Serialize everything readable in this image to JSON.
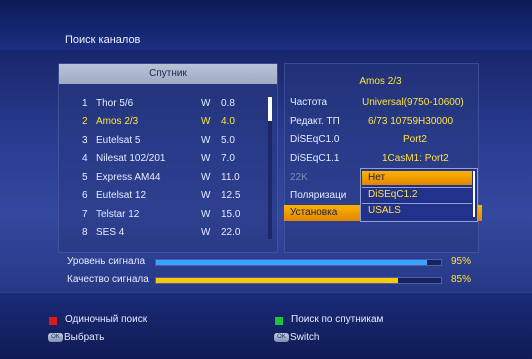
{
  "header": {
    "title": "Поиск каналов"
  },
  "satellite_panel": {
    "heading": "Спутник",
    "items": [
      {
        "num": "1",
        "name": "Thor 5/6",
        "dir": "W",
        "deg": "0.8"
      },
      {
        "num": "2",
        "name": "Amos 2/3",
        "dir": "W",
        "deg": "4.0"
      },
      {
        "num": "3",
        "name": "Eutelsat 5",
        "dir": "W",
        "deg": "5.0"
      },
      {
        "num": "4",
        "name": "Nilesat 102/201",
        "dir": "W",
        "deg": "7.0"
      },
      {
        "num": "5",
        "name": "Express AM44",
        "dir": "W",
        "deg": "11.0"
      },
      {
        "num": "6",
        "name": "Eutelsat 12",
        "dir": "W",
        "deg": "12.5"
      },
      {
        "num": "7",
        "name": "Telstar 12",
        "dir": "W",
        "deg": "15.0"
      },
      {
        "num": "8",
        "name": "SES 4",
        "dir": "W",
        "deg": "22.0"
      }
    ],
    "selected_index": 1
  },
  "params_panel": {
    "title": "Amos 2/3",
    "rows": [
      {
        "label": "Частота",
        "value": "Universal(9750-10600)"
      },
      {
        "label": "Редакт. ТП",
        "value": "6/73 10759H30000"
      },
      {
        "label": "DiSEqC1.0",
        "value": "Port2"
      },
      {
        "label": "DiSEqC1.1",
        "value": "1CasM1: Port2"
      },
      {
        "label": "22K",
        "value": ""
      },
      {
        "label": "Поляризаци",
        "value": ""
      }
    ],
    "install_label": "Установка"
  },
  "dropdown": {
    "options": [
      "Нет",
      "DiSEqC1.2",
      "USALS"
    ],
    "highlighted_index": 0
  },
  "signal": {
    "level_label": "Уровень сигнала",
    "level_pct": "95%",
    "level_value": 95,
    "quality_label": "Качество сигнала",
    "quality_pct": "85%",
    "quality_value": 85
  },
  "footer": {
    "red_label": "Одиночный поиск",
    "green_label": "Поиск по спутникам",
    "ok_left_label": "Выбрать",
    "ok_right_label": "Switch",
    "ok_key": "OK"
  },
  "colors": {
    "highlight_yellow": "#ffe43a",
    "orange": "#f0a000",
    "red": "#e01818",
    "green": "#1ec33a",
    "level_bar": "#3aa3ff",
    "quality_bar": "#ffc800"
  }
}
